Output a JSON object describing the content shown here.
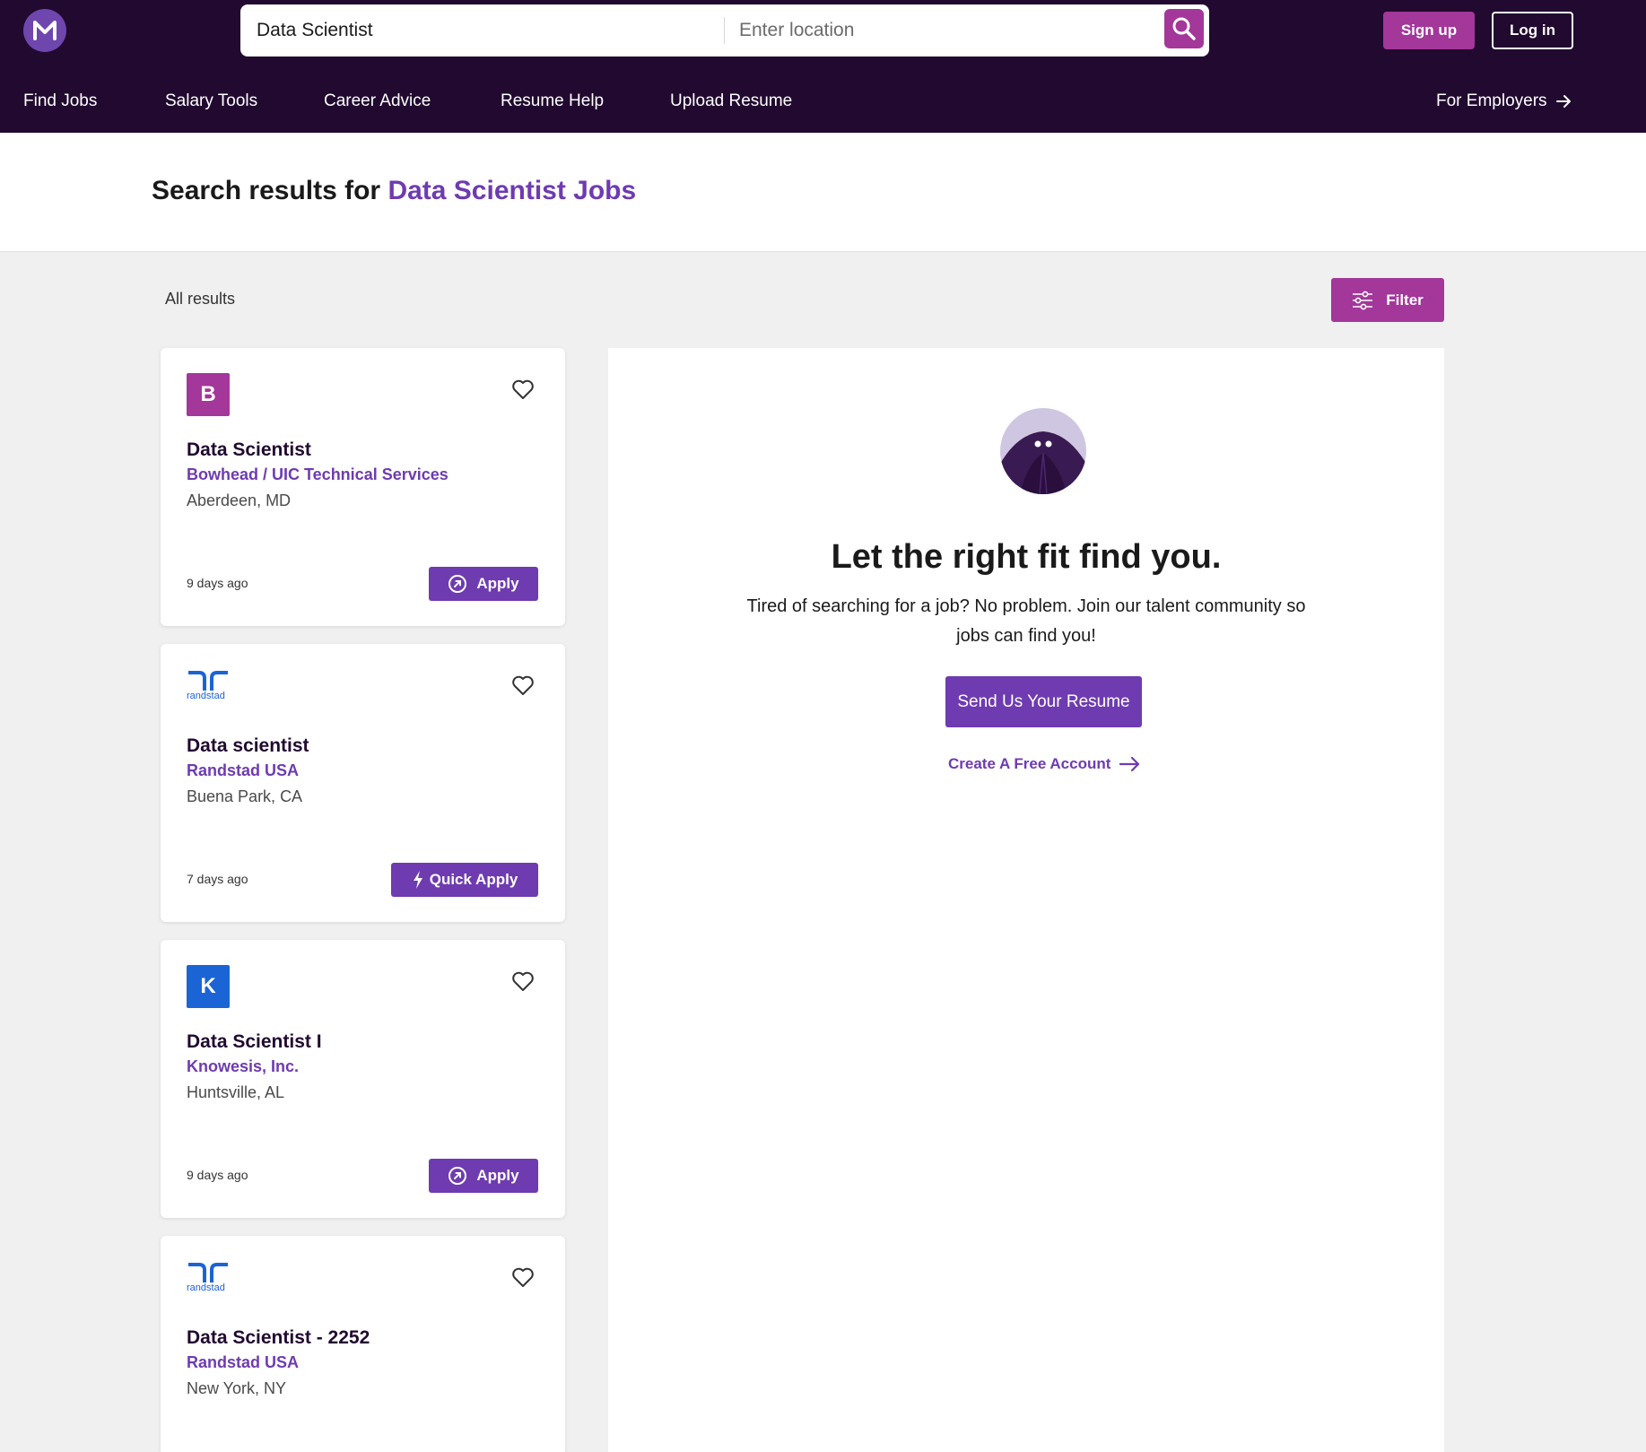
{
  "header": {
    "logo_letter": "M",
    "search": {
      "keyword_value": "Data Scientist",
      "location_placeholder": "Enter location"
    },
    "signup_label": "Sign up",
    "login_label": "Log in",
    "nav": [
      {
        "label": "Find Jobs"
      },
      {
        "label": "Salary Tools"
      },
      {
        "label": "Career Advice"
      },
      {
        "label": "Resume Help"
      },
      {
        "label": "Upload Resume"
      }
    ],
    "employers_label": "For Employers"
  },
  "page": {
    "title_prefix": "Search results for ",
    "title_highlight": "Data Scientist Jobs",
    "all_results_label": "All results",
    "filter_label": "Filter"
  },
  "jobs": [
    {
      "logo": "B",
      "logo_color": "#a3379a",
      "title": "Data Scientist",
      "company": "Bowhead / UIC Technical Services",
      "location": "Aberdeen, MD",
      "posted": "9 days ago",
      "action": "Apply"
    },
    {
      "logo": "randstad",
      "logo_color": "#1b64d6",
      "title": "Data scientist",
      "company": "Randstad USA",
      "location": "Buena Park, CA",
      "posted": "7 days ago",
      "action": "Quick Apply"
    },
    {
      "logo": "K",
      "logo_color": "#1b64d6",
      "title": "Data Scientist I",
      "company": "Knowesis, Inc.",
      "location": "Huntsville, AL",
      "posted": "9 days ago",
      "action": "Apply"
    },
    {
      "logo": "randstad",
      "logo_color": "#1b64d6",
      "title": "Data Scientist - 2252",
      "company": "Randstad USA",
      "location": "New York, NY"
    }
  ],
  "promo": {
    "heading": "Let the right fit find you.",
    "text": "Tired of searching for a job? No problem. Join our talent community so jobs can find you!",
    "resume_button": "Send Us Your Resume",
    "create_account": "Create A Free Account"
  },
  "colors": {
    "header_bg": "#21092f",
    "primary_purple": "#6e3bb0",
    "magenta": "#a3379a",
    "randstad_blue": "#1b64d6"
  }
}
